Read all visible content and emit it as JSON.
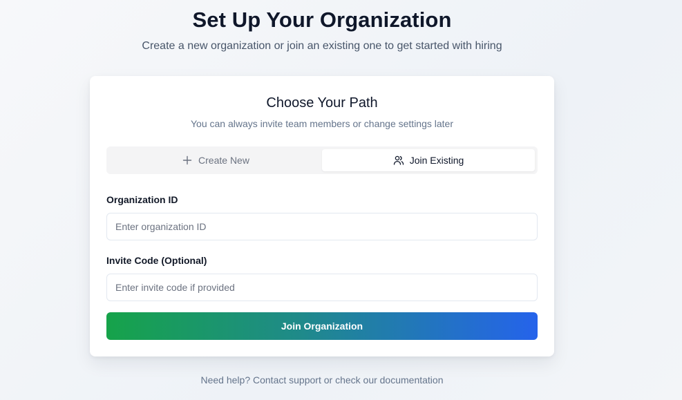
{
  "header": {
    "title": "Set Up Your Organization",
    "subtitle": "Create a new organization or join an existing one to get started with hiring"
  },
  "card": {
    "title": "Choose Your Path",
    "subtitle": "You can always invite team members or change settings later",
    "tabs": [
      {
        "label": "Create New",
        "icon": "plus-icon",
        "selected": false
      },
      {
        "label": "Join Existing",
        "icon": "users-icon",
        "selected": true
      }
    ],
    "form": {
      "org_id_label": "Organization ID",
      "org_id_placeholder": "Enter organization ID",
      "org_id_value": "",
      "invite_label": "Invite Code (Optional)",
      "invite_placeholder": "Enter invite code if provided",
      "invite_value": "",
      "submit_label": "Join Organization"
    }
  },
  "footer": {
    "help_text": "Need help? Contact support or check our documentation"
  },
  "colors": {
    "button_gradient_start": "#16a34a",
    "button_gradient_end": "#2563eb",
    "tab_bar_bg": "#f4f4f5",
    "text_dark": "#0f172a",
    "text_muted": "#64748b"
  }
}
